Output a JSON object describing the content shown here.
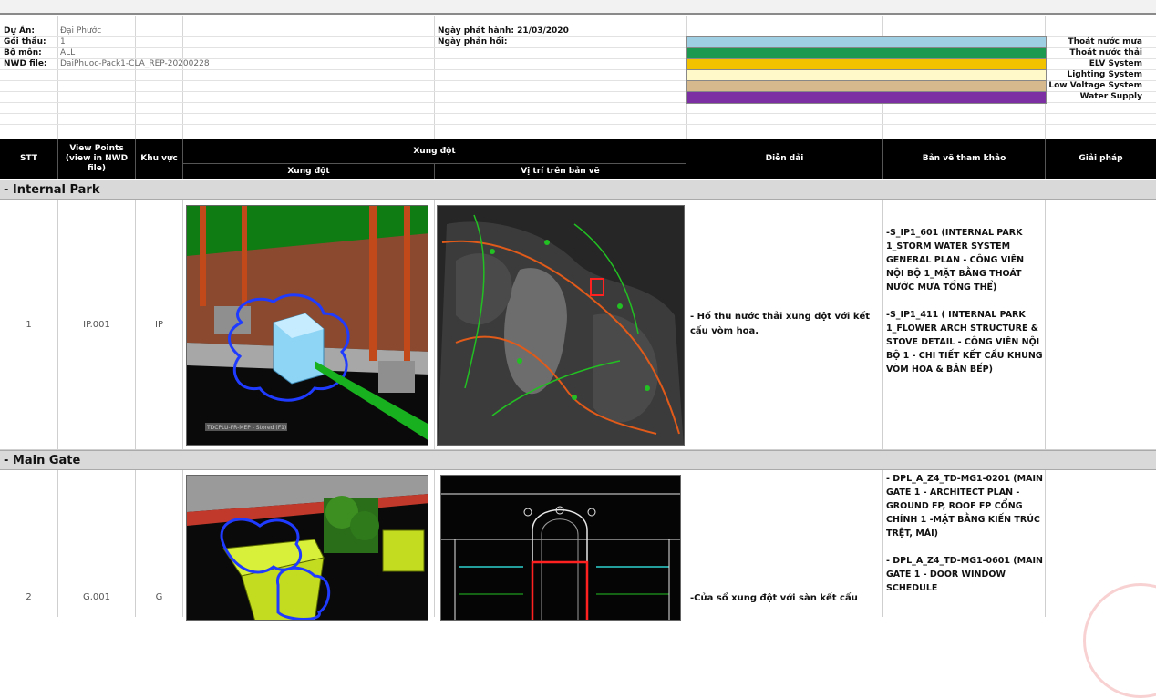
{
  "header": {
    "project_label": "Dự Án:",
    "project_value": "Đại Phước",
    "package_label": "Gói thầu:",
    "package_value": "1",
    "discipline_label": "Bộ môn:",
    "discipline_value": "ALL",
    "nwd_label": "NWD file:",
    "nwd_value": "DaiPhuoc-Pack1-CLA_REP-20200228",
    "issue_date": "Ngày phát hành: 21/03/2020",
    "reply_date": "Ngày phản hồi:"
  },
  "legend": [
    {
      "label": "Thoát nước mưa",
      "color": "#9fcfe2"
    },
    {
      "label": "Thoát nước thải",
      "color": "#1e9a50"
    },
    {
      "label": "ELV System",
      "color": "#f2c200"
    },
    {
      "label": "Lighting System",
      "color": "#fff8c8"
    },
    {
      "label": "Low Voltage System",
      "color": "#d7b98e"
    },
    {
      "label": "Water Supply",
      "color": "#7b2fa2"
    }
  ],
  "columns": {
    "stt": "STT",
    "viewpoints": "View Points (view in NWD file)",
    "area": "Khu vực",
    "clash_group": "Xung đột",
    "clash": "Xung đột",
    "location": "Vị trí trên bản vẽ",
    "description": "Diễn dải",
    "reference": "Bản vẽ tham khảo",
    "solution": "Giải pháp"
  },
  "sections": [
    {
      "title": "- Internal Park",
      "row": {
        "stt": "1",
        "viewpoint": "IP.001",
        "area": "IP",
        "description": "- Hố thu nước thải xung đột với kết cấu vòm hoa.",
        "image_caption": "TDCPLU-FR-MEP - Stored (F1)",
        "references": [
          "-S_IP1_601 (INTERNAL PARK 1_STORM WATER SYSTEM GENERAL PLAN - CÔNG VIÊN NỘI BỘ 1_MẶT BẰNG THOÁT NƯỚC MƯA TỔNG THỂ)",
          "-S_IP1_411 ( INTERNAL PARK 1_FLOWER ARCH STRUCTURE & STOVE DETAIL - CÔNG VIÊN NỘI BỘ 1 - CHI TIẾT KẾT CẤU KHUNG VÒM HOA & BẢN BẾP)"
        ],
        "solution": ""
      }
    },
    {
      "title": "- Main Gate",
      "row": {
        "stt": "2",
        "viewpoint": "G.001",
        "area": "G",
        "description": "-Cửa sổ xung đột với sàn kết cấu",
        "references": [
          "- DPL_A_Z4_TD-MG1-0201 (MAIN GATE 1 - ARCHITECT PLAN - GROUND FP, ROOF FP CỔNG CHÍNH 1 -MẶT BẰNG KIẾN TRÚC TRỆT, MÁI)",
          "- DPL_A_Z4_TD-MG1-0601 (MAIN GATE 1 - DOOR WINDOW SCHEDULE"
        ],
        "solution": ""
      }
    }
  ]
}
